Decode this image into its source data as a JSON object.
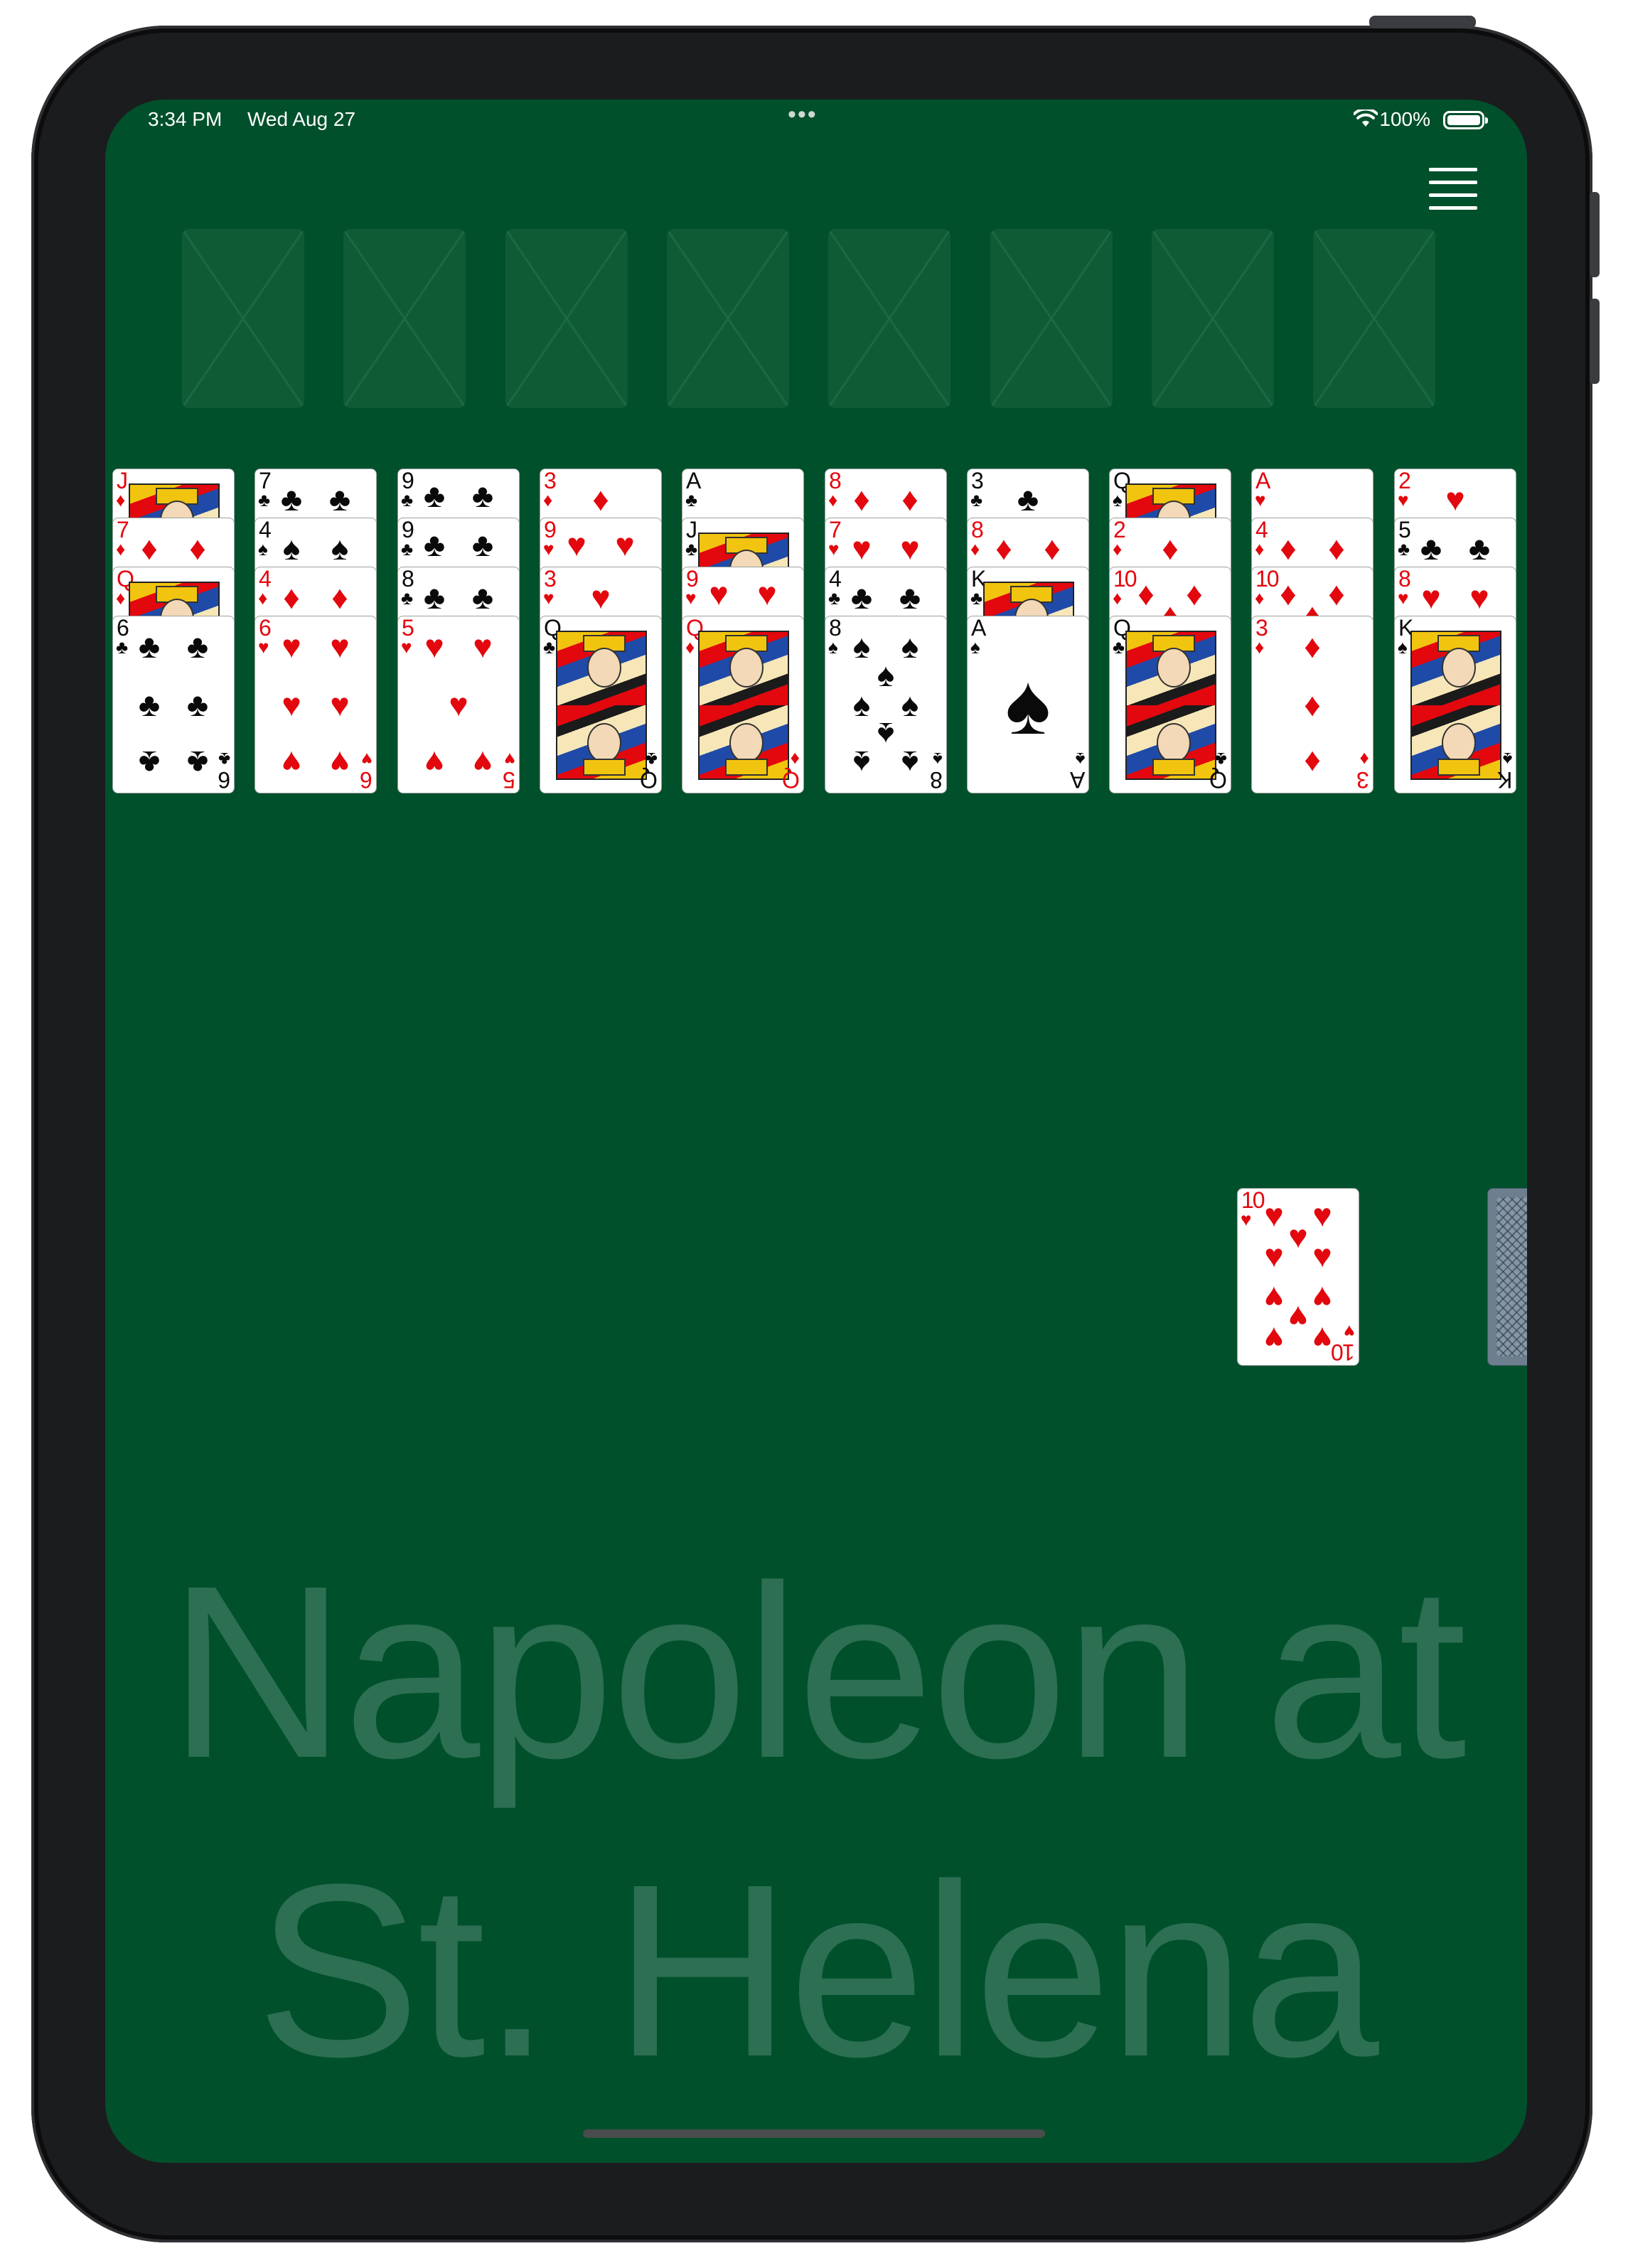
{
  "status_bar": {
    "time": "3:34 PM",
    "date": "Wed Aug 27",
    "dots": "•••",
    "battery_text": "100%"
  },
  "menu": {
    "icon": "hamburger-menu-icon"
  },
  "game": {
    "title_line1": "Napoleon at",
    "title_line2": "St. Helena"
  },
  "foundations_count": 8,
  "tableau": [
    {
      "cards": [
        {
          "rank": "J",
          "suit": "♦"
        },
        {
          "rank": "7",
          "suit": "♦"
        },
        {
          "rank": "Q",
          "suit": "♦"
        },
        {
          "rank": "6",
          "suit": "♣"
        }
      ]
    },
    {
      "cards": [
        {
          "rank": "7",
          "suit": "♣"
        },
        {
          "rank": "4",
          "suit": "♠"
        },
        {
          "rank": "4",
          "suit": "♦"
        },
        {
          "rank": "6",
          "suit": "♥"
        }
      ]
    },
    {
      "cards": [
        {
          "rank": "9",
          "suit": "♣"
        },
        {
          "rank": "9",
          "suit": "♣"
        },
        {
          "rank": "8",
          "suit": "♣"
        },
        {
          "rank": "5",
          "suit": "♥"
        }
      ]
    },
    {
      "cards": [
        {
          "rank": "3",
          "suit": "♦"
        },
        {
          "rank": "9",
          "suit": "♥"
        },
        {
          "rank": "3",
          "suit": "♥"
        },
        {
          "rank": "Q",
          "suit": "♣"
        }
      ]
    },
    {
      "cards": [
        {
          "rank": "A",
          "suit": "♣"
        },
        {
          "rank": "J",
          "suit": "♣"
        },
        {
          "rank": "9",
          "suit": "♥"
        },
        {
          "rank": "Q",
          "suit": "♦"
        }
      ]
    },
    {
      "cards": [
        {
          "rank": "8",
          "suit": "♦"
        },
        {
          "rank": "7",
          "suit": "♥"
        },
        {
          "rank": "4",
          "suit": "♣"
        },
        {
          "rank": "8",
          "suit": "♠"
        }
      ]
    },
    {
      "cards": [
        {
          "rank": "3",
          "suit": "♣"
        },
        {
          "rank": "8",
          "suit": "♦"
        },
        {
          "rank": "K",
          "suit": "♣"
        },
        {
          "rank": "A",
          "suit": "♠"
        }
      ]
    },
    {
      "cards": [
        {
          "rank": "Q",
          "suit": "♠"
        },
        {
          "rank": "2",
          "suit": "♦"
        },
        {
          "rank": "10",
          "suit": "♦"
        },
        {
          "rank": "Q",
          "suit": "♣"
        }
      ]
    },
    {
      "cards": [
        {
          "rank": "A",
          "suit": "♥"
        },
        {
          "rank": "4",
          "suit": "♦"
        },
        {
          "rank": "10",
          "suit": "♦"
        },
        {
          "rank": "3",
          "suit": "♦"
        }
      ]
    },
    {
      "cards": [
        {
          "rank": "2",
          "suit": "♥"
        },
        {
          "rank": "5",
          "suit": "♣"
        },
        {
          "rank": "8",
          "suit": "♥"
        },
        {
          "rank": "K",
          "suit": "♠"
        }
      ]
    }
  ],
  "waste": {
    "rank": "10",
    "suit": "♥"
  },
  "stock": {
    "face_down": true
  }
}
